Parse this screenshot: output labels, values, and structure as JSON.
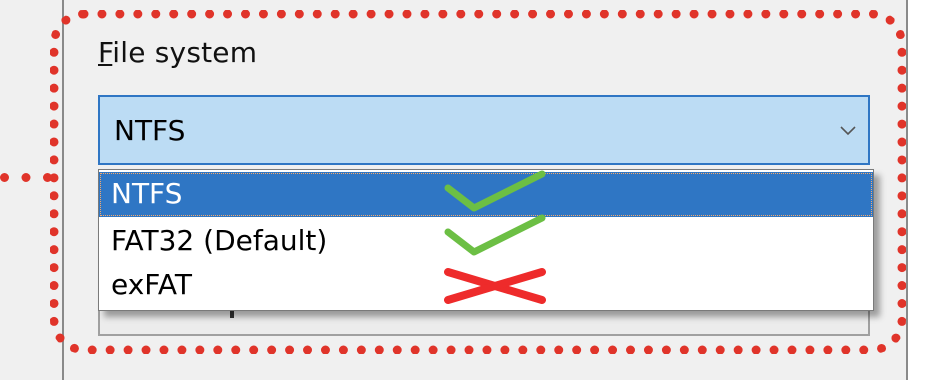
{
  "field": {
    "label_mnemonic": "F",
    "label_rest": "ile system",
    "selected_value": "NTFS",
    "chevron_icon": "chevron-down-icon"
  },
  "options": [
    {
      "label": "NTFS",
      "selected": true,
      "annotation": "check-mark-icon"
    },
    {
      "label": "FAT32 (Default)",
      "selected": false,
      "annotation": "check-mark-icon"
    },
    {
      "label": "exFAT",
      "selected": false,
      "annotation": "cross-mark-icon"
    }
  ],
  "colors": {
    "highlight": "#e0342a",
    "check": "#6cbf44",
    "cross": "#ee2b2b",
    "selection": "#2f76c4",
    "combo_background": "#bcdcf4"
  }
}
